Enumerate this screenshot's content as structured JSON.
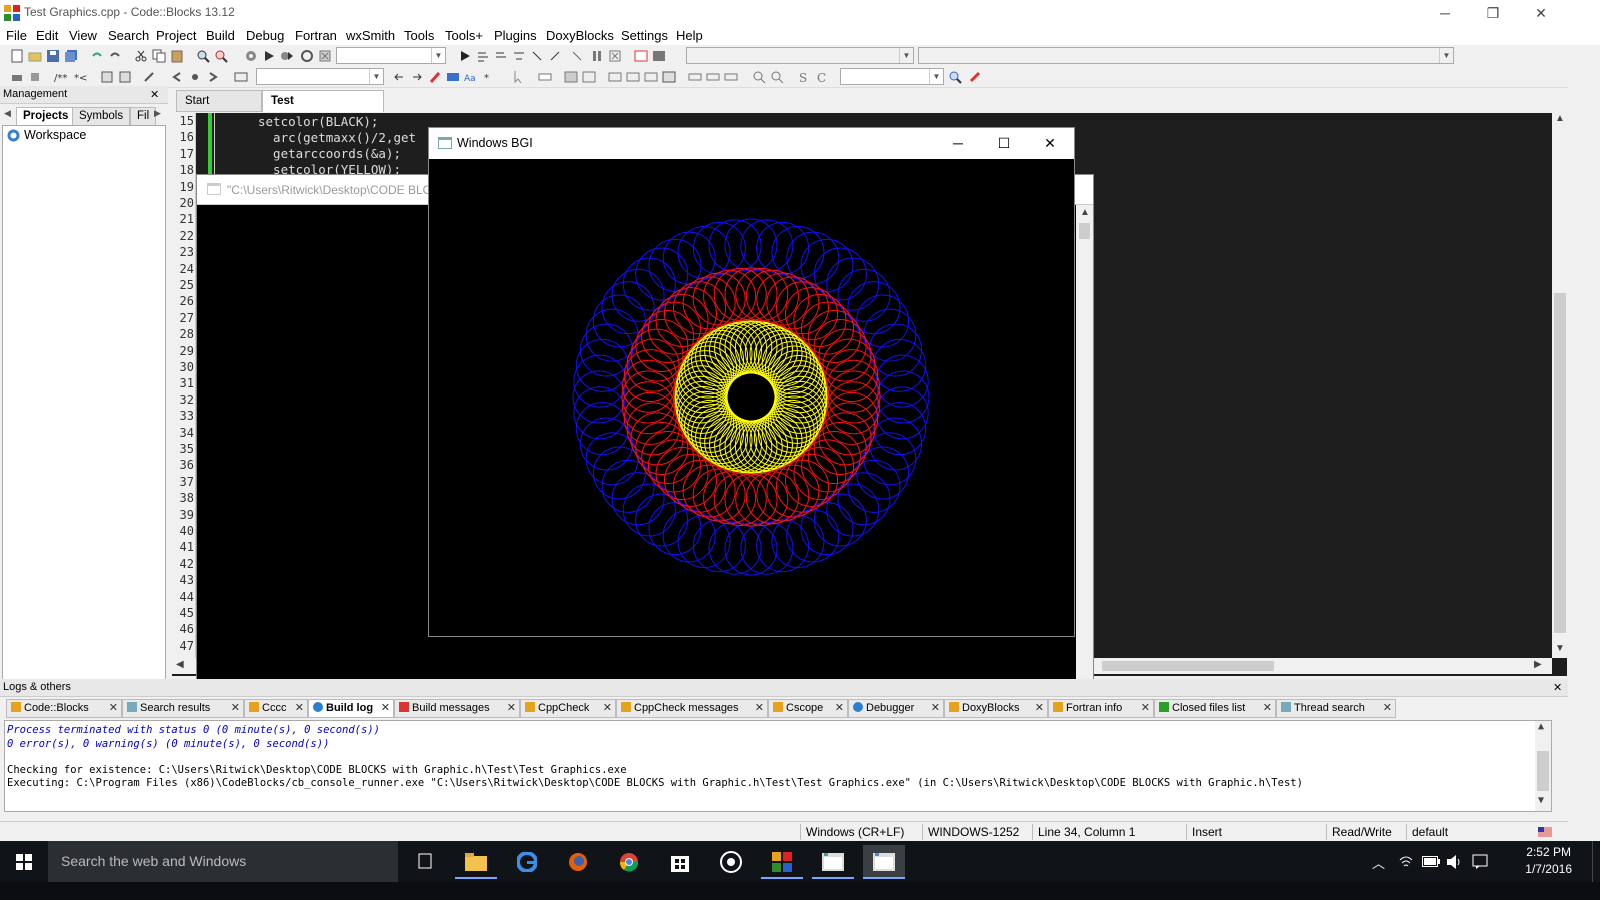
{
  "window": {
    "title": "Test Graphics.cpp - Code::Blocks 13.12",
    "minimize": "─",
    "restore": "❐",
    "close": "✕"
  },
  "menu": [
    "File",
    "Edit",
    "View",
    "Search",
    "Project",
    "Build",
    "Debug",
    "Fortran",
    "wxSmith",
    "Tools",
    "Tools+",
    "Plugins",
    "DoxyBlocks",
    "Settings",
    "Help"
  ],
  "management": {
    "title": "Management",
    "close": "✕",
    "tabs": [
      "Projects",
      "Symbols",
      "Fil"
    ],
    "tree_item": "Workspace"
  },
  "editor": {
    "tabs": [
      {
        "label": "Start here",
        "close": "✕"
      },
      {
        "label": "Test Graphics.cpp",
        "close": "✕"
      }
    ],
    "line_numbers": [
      "15",
      "16",
      "17",
      "18",
      "19",
      "20",
      "21",
      "22",
      "23",
      "24",
      "25",
      "26",
      "27",
      "28",
      "29",
      "30",
      "31",
      "32",
      "33",
      "34",
      "35",
      "36",
      "37",
      "38",
      "39",
      "40",
      "41",
      "42",
      "43",
      "44",
      "45",
      "46",
      "47"
    ],
    "code": [
      "setcolor(BLACK);",
      "  arc(getmaxx()/2,get",
      "  getarccoords(&a);",
      "  setcolor(YELLOW);"
    ]
  },
  "console": {
    "title": "\"C:\\Users\\Ritwick\\Desktop\\CODE BLO"
  },
  "bgi": {
    "title": "Windows BGI",
    "colors": {
      "outer": "#1010ff",
      "middle": "#ff1010",
      "inner": "#ffff00"
    }
  },
  "logs": {
    "title": "Logs & others",
    "close": "✕",
    "tabs": [
      "Code::Blocks",
      "Search results",
      "Cccc",
      "Build log",
      "Build messages",
      "CppCheck",
      "CppCheck messages",
      "Cscope",
      "Debugger",
      "DoxyBlocks",
      "Fortran info",
      "Closed files list",
      "Thread search"
    ],
    "active_tab": "Build log",
    "lines": [
      "Process terminated with status 0 (0 minute(s), 0 second(s))",
      "0 error(s), 0 warning(s) (0 minute(s), 0 second(s))",
      "",
      "Checking for existence: C:\\Users\\Ritwick\\Desktop\\CODE BLOCKS with Graphic.h\\Test\\Test Graphics.exe",
      "Executing: C:\\Program Files (x86)\\CodeBlocks/cb_console_runner.exe \"C:\\Users\\Ritwick\\Desktop\\CODE BLOCKS with Graphic.h\\Test\\Test Graphics.exe\" (in C:\\Users\\Ritwick\\Desktop\\CODE BLOCKS with Graphic.h\\Test)"
    ]
  },
  "status": {
    "eol": "Windows (CR+LF)",
    "encoding": "WINDOWS-1252",
    "position": "Line 34, Column 1",
    "mode": "Insert",
    "access": "Read/Write",
    "lang": "default"
  },
  "taskbar": {
    "search": "Search the web and Windows",
    "time": "2:52 PM",
    "date": "1/7/2016"
  }
}
